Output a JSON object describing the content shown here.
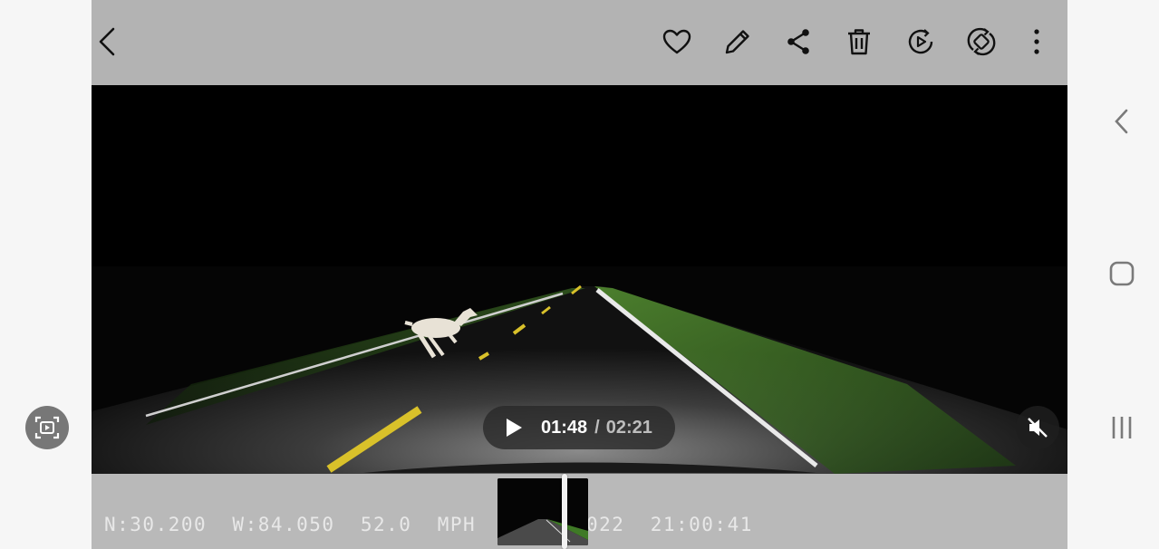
{
  "toolbar": {
    "back": "back-icon",
    "icons": [
      "heart-icon",
      "edit-icon",
      "share-icon",
      "delete-icon",
      "remaster-icon",
      "auto-rotate-icon",
      "more-icon"
    ]
  },
  "player": {
    "current_time": "01:48",
    "separator": "/",
    "total_time": "02:21",
    "muted": true
  },
  "dashcam": {
    "overlay_left": "N:30.200  W:84.050  52.0  MPH",
    "overlay_right": "022  21:00:41"
  },
  "colors": {
    "toolbar_bg": "#b3b3b3",
    "bottom_bg": "#b9b9b9",
    "pill_bg": "#282828",
    "grass": "#4c8a2e",
    "road_line_yellow": "#d9c12a"
  }
}
